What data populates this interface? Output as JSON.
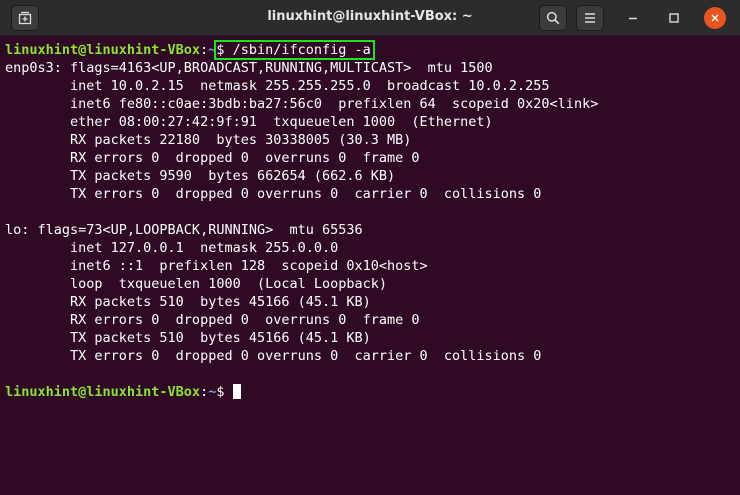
{
  "window": {
    "title": "linuxhint@linuxhint-VBox: ~"
  },
  "titlebar_icons": {
    "new_tab": "new-tab-icon",
    "search": "search-icon",
    "menu": "hamburger-menu-icon",
    "minimize": "minimize-icon",
    "maximize": "maximize-icon",
    "close": "close-icon"
  },
  "colors": {
    "terminal_bg": "#300a24",
    "prompt_user": "#8ae234",
    "prompt_path": "#729fcf",
    "highlight_box": "#19e619",
    "close_button": "#e95420"
  },
  "terminal": {
    "prompt1": {
      "user": "linuxhint@linuxhint-VBox",
      "sep": ":",
      "path": "~",
      "command": "$ /sbin/ifconfig -a"
    },
    "output": [
      "enp0s3: flags=4163<UP,BROADCAST,RUNNING,MULTICAST>  mtu 1500",
      "        inet 10.0.2.15  netmask 255.255.255.0  broadcast 10.0.2.255",
      "        inet6 fe80::c0ae:3bdb:ba27:56c0  prefixlen 64  scopeid 0x20<link>",
      "        ether 08:00:27:42:9f:91  txqueuelen 1000  (Ethernet)",
      "        RX packets 22180  bytes 30338005 (30.3 MB)",
      "        RX errors 0  dropped 0  overruns 0  frame 0",
      "        TX packets 9590  bytes 662654 (662.6 KB)",
      "        TX errors 0  dropped 0 overruns 0  carrier 0  collisions 0",
      "",
      "lo: flags=73<UP,LOOPBACK,RUNNING>  mtu 65536",
      "        inet 127.0.0.1  netmask 255.0.0.0",
      "        inet6 ::1  prefixlen 128  scopeid 0x10<host>",
      "        loop  txqueuelen 1000  (Local Loopback)",
      "        RX packets 510  bytes 45166 (45.1 KB)",
      "        RX errors 0  dropped 0  overruns 0  frame 0",
      "        TX packets 510  bytes 45166 (45.1 KB)",
      "        TX errors 0  dropped 0 overruns 0  carrier 0  collisions 0",
      ""
    ],
    "prompt2": {
      "user": "linuxhint@linuxhint-VBox",
      "sep": ":",
      "path": "~",
      "command": "$ "
    }
  }
}
